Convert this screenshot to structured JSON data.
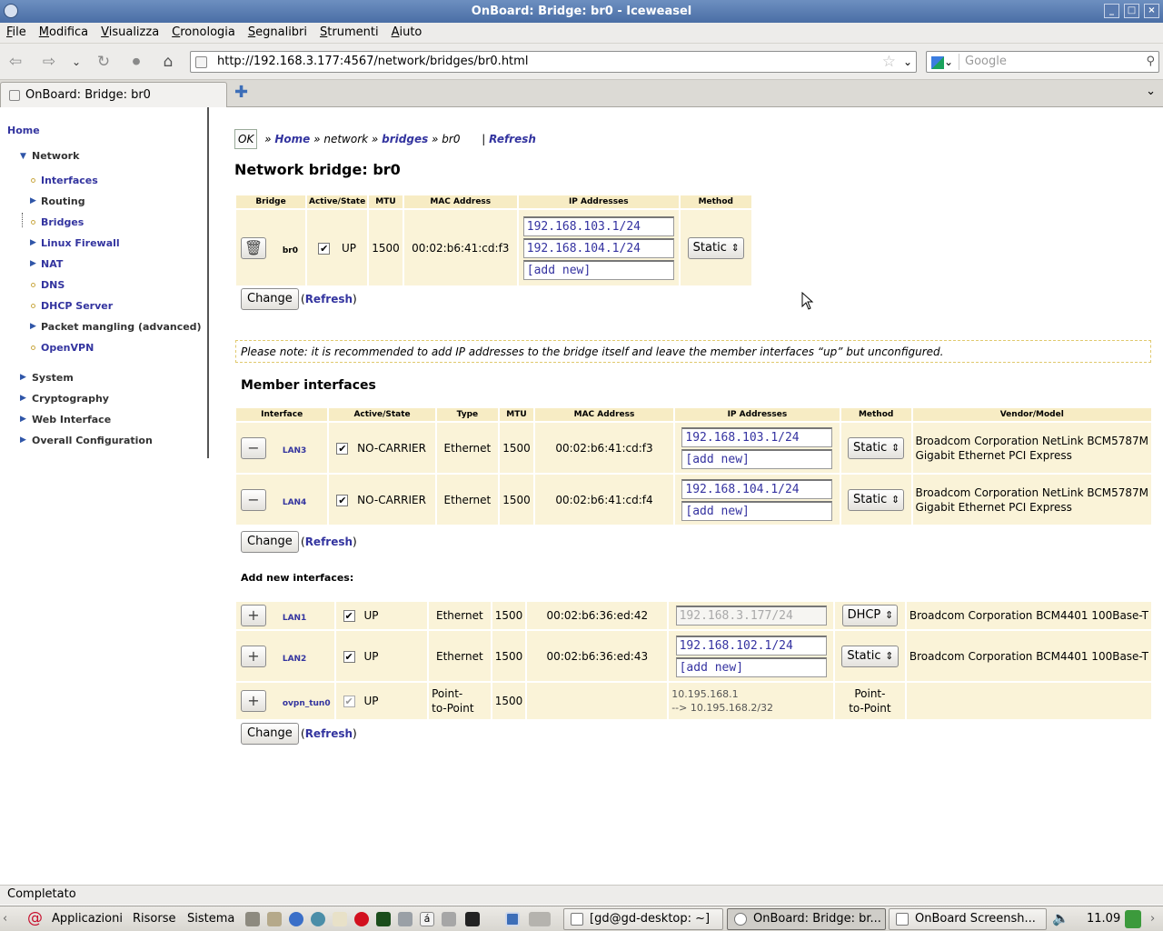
{
  "window": {
    "title": "OnBoard: Bridge: br0 - Iceweasel"
  },
  "menu": [
    "File",
    "Modifica",
    "Visualizza",
    "Cronologia",
    "Segnalibri",
    "Strumenti",
    "Aiuto"
  ],
  "navbar": {
    "url": "http://192.168.3.177:4567/network/bridges/br0.html",
    "search_placeholder": "Google"
  },
  "tab": {
    "label": "OnBoard: Bridge: br0"
  },
  "sidebar": {
    "home": "Home",
    "network": "Network",
    "items": [
      "Interfaces",
      "Routing",
      "Bridges",
      "Linux Firewall",
      "NAT",
      "DNS",
      "DHCP Server",
      "Packet mangling (advanced)",
      "OpenVPN"
    ],
    "groups": [
      "System",
      "Cryptography",
      "Web Interface",
      "Overall Configuration"
    ]
  },
  "breadcrumb": {
    "ok": "OK",
    "home": "Home",
    "network": "network",
    "bridges": "bridges",
    "current": "br0",
    "refresh": "Refresh"
  },
  "page_title": "Network bridge: br0",
  "bridge_table": {
    "headers": [
      "Bridge",
      "Active/State",
      "MTU",
      "MAC Address",
      "IP Addresses",
      "Method"
    ],
    "row": {
      "name": "br0",
      "state": "UP",
      "mtu": "1500",
      "mac": "00:02:b6:41:cd:f3",
      "ips": [
        "192.168.103.1/24",
        "192.168.104.1/24"
      ],
      "add_new": "[add new]",
      "method": "Static"
    }
  },
  "buttons": {
    "change": "Change",
    "refresh": "Refresh"
  },
  "note": "Please note: it is recommended to add IP addresses to the bridge itself and leave the member interfaces “up” but unconfigured.",
  "member_title": "Member interfaces",
  "member_table": {
    "headers": [
      "Interface",
      "Active/State",
      "Type",
      "MTU",
      "MAC Address",
      "IP Addresses",
      "Method",
      "Vendor/Model"
    ],
    "rows": [
      {
        "name": "LAN3",
        "state": "NO-CARRIER",
        "type": "Ethernet",
        "mtu": "1500",
        "mac": "00:02:b6:41:cd:f3",
        "ip": "192.168.103.1/24",
        "add_new": "[add new]",
        "method": "Static",
        "vendor1": "Broadcom Corporation NetLink BCM5787M",
        "vendor2": "Gigabit Ethernet PCI Express"
      },
      {
        "name": "LAN4",
        "state": "NO-CARRIER",
        "type": "Ethernet",
        "mtu": "1500",
        "mac": "00:02:b6:41:cd:f4",
        "ip": "192.168.104.1/24",
        "add_new": "[add new]",
        "method": "Static",
        "vendor1": "Broadcom Corporation NetLink BCM5787M",
        "vendor2": "Gigabit Ethernet PCI Express"
      }
    ]
  },
  "add_title": "Add new interfaces:",
  "add_table": {
    "rows": [
      {
        "name": "LAN1",
        "state": "UP",
        "type": "Ethernet",
        "mtu": "1500",
        "mac": "00:02:b6:36:ed:42",
        "ip": "192.168.3.177/24",
        "method": "DHCP",
        "vendor": "Broadcom Corporation BCM4401 100Base-T"
      },
      {
        "name": "LAN2",
        "state": "UP",
        "type": "Ethernet",
        "mtu": "1500",
        "mac": "00:02:b6:36:ed:43",
        "ip": "192.168.102.1/24",
        "add_new": "[add new]",
        "method": "Static",
        "vendor": "Broadcom Corporation BCM4401 100Base-T"
      },
      {
        "name": "ovpn_tun0",
        "state": "UP",
        "type1": "Point-",
        "type2": "to-Point",
        "mtu": "1500",
        "ip1": "10.195.168.1",
        "ip2": "--> 10.195.168.2/32",
        "method1": "Point-",
        "method2": "to-Point"
      }
    ]
  },
  "statusbar": "Completato",
  "panel": {
    "menus": [
      "Applicazioni",
      "Risorse",
      "Sistema"
    ],
    "tasks": [
      "[gd@gd-desktop: ~]",
      "OnBoard: Bridge: br...",
      "OnBoard Screensh..."
    ],
    "clock": "11.09"
  }
}
